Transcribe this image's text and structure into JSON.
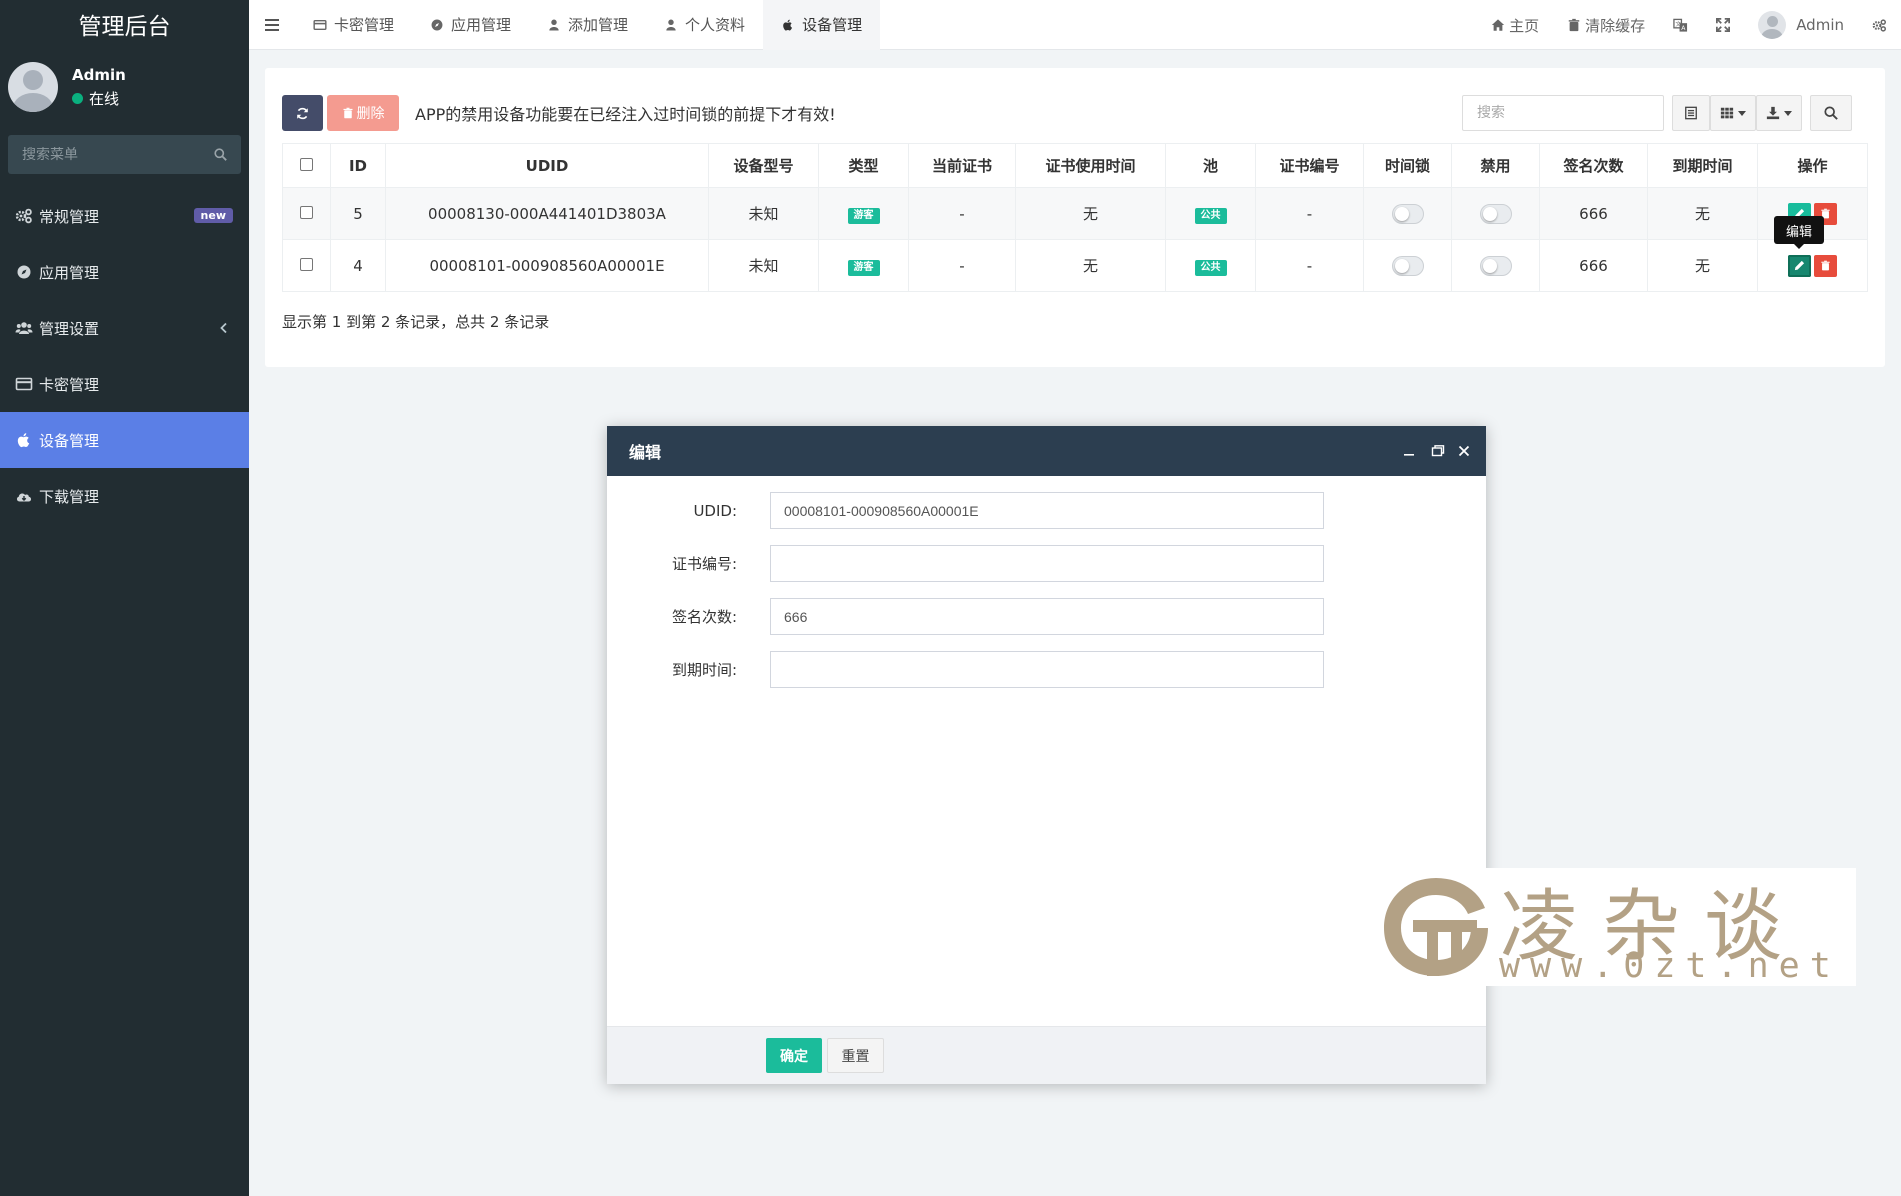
{
  "sidebar": {
    "logo": "管理后台",
    "user_name": "Admin",
    "user_status": "在线",
    "search_placeholder": "搜索菜单",
    "items": [
      {
        "label": "常规管理",
        "icon": "cogs-icon",
        "badge": "new"
      },
      {
        "label": "应用管理",
        "icon": "compass-icon"
      },
      {
        "label": "管理设置",
        "icon": "users-icon"
      },
      {
        "label": "卡密管理",
        "icon": "credit-card-icon"
      },
      {
        "label": "设备管理",
        "icon": "apple-icon",
        "active": true
      },
      {
        "label": "下载管理",
        "icon": "cloud-download-icon"
      }
    ]
  },
  "topbar": {
    "tabs": [
      {
        "label": "卡密管理",
        "icon": "credit-card-icon"
      },
      {
        "label": "应用管理",
        "icon": "compass-icon"
      },
      {
        "label": "添加管理",
        "icon": "user-icon"
      },
      {
        "label": "个人资料",
        "icon": "user-icon"
      },
      {
        "label": "设备管理",
        "icon": "apple-icon",
        "active": true
      }
    ],
    "home_label": "主页",
    "clear_cache_label": "清除缓存",
    "user_name": "Admin"
  },
  "toolbar": {
    "delete_label": "删除",
    "notice": "APP的禁用设备功能要在已经注入过时间锁的前提下才有效!",
    "search_placeholder": "搜索"
  },
  "table": {
    "headers": [
      "ID",
      "UDID",
      "设备型号",
      "类型",
      "当前证书",
      "证书使用时间",
      "池",
      "证书编号",
      "时间锁",
      "禁用",
      "签名次数",
      "到期时间",
      "操作"
    ],
    "rows": [
      {
        "id": "5",
        "udid": "00008130-000A441401D3803A",
        "model": "未知",
        "type": "游客",
        "cert": "-",
        "cert_time": "无",
        "pool": "公共",
        "cert_no": "-",
        "time_lock": false,
        "disabled": false,
        "sign_count": "666",
        "expire": "无"
      },
      {
        "id": "4",
        "udid": "00008101-000908560A00001E",
        "model": "未知",
        "type": "游客",
        "cert": "-",
        "cert_time": "无",
        "pool": "公共",
        "cert_no": "-",
        "time_lock": false,
        "disabled": false,
        "sign_count": "666",
        "expire": "无"
      }
    ],
    "tooltip": "编辑",
    "pagination_info": "显示第 1 到第 2 条记录，总共 2 条记录"
  },
  "modal": {
    "title": "编辑",
    "fields": [
      {
        "label": "UDID:",
        "value": "00008101-000908560A00001E"
      },
      {
        "label": "证书编号:",
        "value": ""
      },
      {
        "label": "签名次数:",
        "value": "666"
      },
      {
        "label": "到期时间:",
        "value": ""
      }
    ],
    "confirm_label": "确定",
    "reset_label": "重置"
  },
  "watermark": {
    "text": "凌杂谈",
    "url": "www.0zt.net"
  },
  "colors": {
    "sidebar_bg": "#222d32",
    "active_menu": "#5b7fe6",
    "accent_green": "#1bbc9b",
    "danger": "#e74c3c",
    "modal_header": "#2c3e50"
  }
}
